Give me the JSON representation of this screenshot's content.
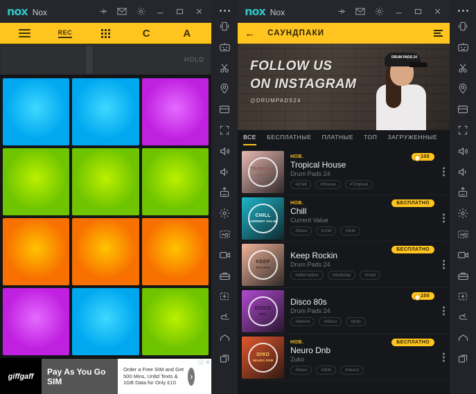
{
  "window": {
    "brand_mark": "nox",
    "brand_text": "Nox",
    "icons": [
      "pin-icon",
      "message-icon",
      "settings-icon",
      "minimize-icon",
      "maximize-icon",
      "close-icon"
    ]
  },
  "left": {
    "toolbar": {
      "menu_label": "menu-icon",
      "rec_label": "REC",
      "grid_label": "grid-icon",
      "loop_label": "C",
      "letter_label": "A"
    },
    "top_strip": {
      "hold_label": "HOLD"
    },
    "pads": [
      {
        "name": "pad-1",
        "color": "#00a8f0",
        "glow": "#3fd8ff"
      },
      {
        "name": "pad-2",
        "color": "#00a8f0",
        "glow": "#3fd8ff"
      },
      {
        "name": "pad-3",
        "color": "#c020e0",
        "glow": "#e46bff"
      },
      {
        "name": "pad-4",
        "color": "#6fc400",
        "glow": "#bbf000"
      },
      {
        "name": "pad-5",
        "color": "#6fc400",
        "glow": "#bbf000"
      },
      {
        "name": "pad-6",
        "color": "#6fc400",
        "glow": "#bbf000"
      },
      {
        "name": "pad-7",
        "color": "#f87000",
        "glow": "#ffc300"
      },
      {
        "name": "pad-8",
        "color": "#f87000",
        "glow": "#ffc300"
      },
      {
        "name": "pad-9",
        "color": "#f87000",
        "glow": "#ffc300"
      },
      {
        "name": "pad-10",
        "color": "#c020e0",
        "glow": "#e46bff"
      },
      {
        "name": "pad-11",
        "color": "#00a8f0",
        "glow": "#3fd8ff"
      },
      {
        "name": "pad-12",
        "color": "#6fc400",
        "glow": "#bbf000"
      }
    ],
    "ad": {
      "advertiser": "giffgaff",
      "headline": "Pay As You Go SIM",
      "body": "Order a Free SIM and Get 500 Mins, Unltd Texts & 1GB Data for Only £10",
      "cta": "›",
      "info_label": "ⓘ",
      "close_label": "✕"
    }
  },
  "right": {
    "header": {
      "back_label": "←",
      "title": "САУНДПАКИ"
    },
    "banner": {
      "line1": "FOLLOW US",
      "line2": "ON INSTAGRAM",
      "handle": "@DRUMPADS24",
      "cap_text": "DRUM PADS 24"
    },
    "tabs": [
      {
        "label": "ВСЕ",
        "active": true
      },
      {
        "label": "БЕСПЛАТНЫЕ",
        "active": false
      },
      {
        "label": "ПЛАТНЫЕ",
        "active": false
      },
      {
        "label": "ТОП",
        "active": false
      },
      {
        "label": "ЗАГРУЖЕННЫЕ",
        "active": false
      }
    ],
    "items": [
      {
        "new_label": "НОВ.",
        "title": "Tropical House",
        "author": "Drum Pads 24",
        "tags": [
          "#Chill",
          "#House",
          "#Tropical"
        ],
        "badge": "100",
        "badge_kind": "coin",
        "thumb_line1": "TROPICAL",
        "thumb_line2": "HOUSE",
        "thumb_bg": "#e8b9b2",
        "thumb_fg": "#8a5b52"
      },
      {
        "new_label": "НОВ.",
        "title": "Chill",
        "author": "Current Value",
        "tags": [
          "#bass",
          "#chill",
          "#dub"
        ],
        "badge": "БЕСПЛАТНО",
        "badge_kind": "free",
        "thumb_line1": "CHILL",
        "thumb_line2": "CURRENT VALUE",
        "thumb_bg": "#1fb6c9",
        "thumb_fg": "#ffffff"
      },
      {
        "new_label": "",
        "title": "Keep Rockin",
        "author": "Drum Pads 24",
        "tags": [
          "#alternative",
          "#dubstep",
          "#rock"
        ],
        "badge": "БЕСПЛАТНО",
        "badge_kind": "free",
        "thumb_line1": "KEEP",
        "thumb_line2": "ROCKIN",
        "thumb_bg": "#f0b49b",
        "thumb_fg": "#3a2a22"
      },
      {
        "new_label": "",
        "title": "Disco 80s",
        "author": "Drum Pads 24",
        "tags": [
          "#dance",
          "#disco",
          "#pop"
        ],
        "badge": "100",
        "badge_kind": "coin",
        "thumb_line1": "DISCO",
        "thumb_line2": "80'S",
        "thumb_bg": "#b24ad0",
        "thumb_fg": "#2a1430"
      },
      {
        "new_label": "НОВ.",
        "title": "Neuro Dnb",
        "author": "Zuko",
        "tags": [
          "#bass",
          "#dnb",
          "#neuro"
        ],
        "badge": "БЕСПЛАТНО",
        "badge_kind": "free",
        "thumb_line1": "ЗУКО",
        "thumb_line2": "NEURO DNB",
        "thumb_bg": "#e4572e",
        "thumb_fg": "#ffd166"
      }
    ]
  },
  "sidebar": {
    "items": [
      "more-icon",
      "shake-phone-icon",
      "keyboard-mapping-icon",
      "scissors-icon",
      "location-icon",
      "layout-icon",
      "fullscreen-icon",
      "volume-up-icon",
      "volume-down-icon",
      "install-apk-icon",
      "performance-icon",
      "screenshot-icon",
      "record-video-icon",
      "toolbox-icon",
      "multi-instance-icon",
      "back-icon",
      "home-icon",
      "recents-icon"
    ]
  }
}
